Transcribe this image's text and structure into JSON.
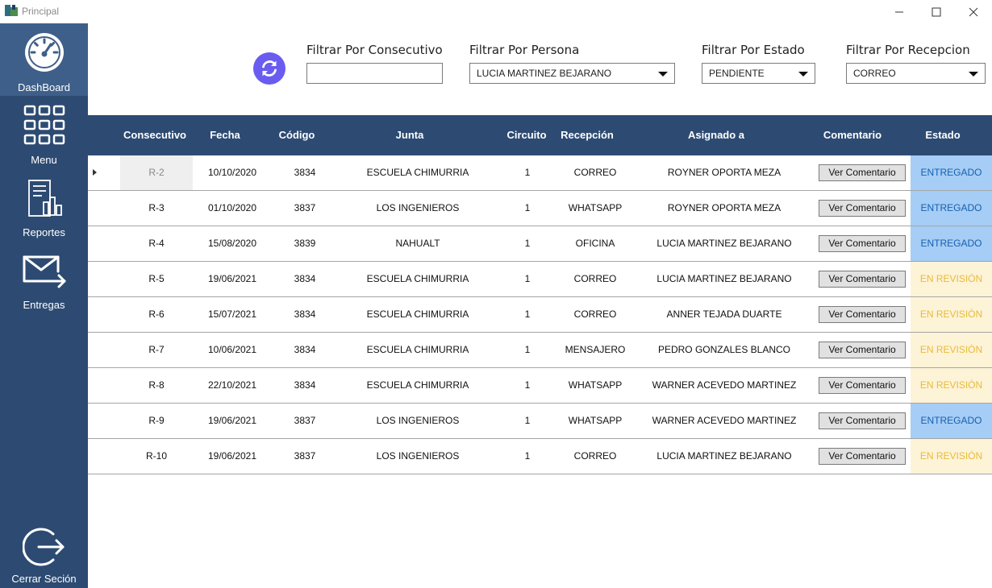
{
  "window": {
    "title": "Principal"
  },
  "sidebar": {
    "items": [
      {
        "label": "DashBoard",
        "icon": "speedometer-icon"
      },
      {
        "label": "Menu",
        "icon": "grid-menu-icon"
      },
      {
        "label": "Reportes",
        "icon": "report-icon"
      },
      {
        "label": "Entregas",
        "icon": "mail-send-icon"
      }
    ],
    "logout": {
      "label": "Cerrar Seción",
      "icon": "logout-icon"
    }
  },
  "filters": {
    "consecutivo": {
      "label": "Filtrar Por Consecutivo",
      "value": ""
    },
    "persona": {
      "label": "Filtrar Por Persona",
      "value": "LUCIA MARTINEZ BEJARANO"
    },
    "estado": {
      "label": "Filtrar Por Estado",
      "value": "PENDIENTE"
    },
    "recepcion": {
      "label": "Filtrar Por Recepcion",
      "value": "CORREO"
    }
  },
  "table": {
    "columns": [
      "Consecutivo",
      "Fecha",
      "Código",
      "Junta",
      "Circuito",
      "Recepción",
      "Asignado a",
      "Comentario",
      "Estado"
    ],
    "button_label": "Ver Comentario",
    "rows": [
      {
        "consecutivo": "R-2",
        "fecha": "10/10/2020",
        "codigo": "3834",
        "junta": "ESCUELA CHIMURRIA",
        "circuito": "1",
        "recepcion": "CORREO",
        "asignado": "ROYNER OPORTA MEZA",
        "estado": "ENTREGADO",
        "tipo": "ok"
      },
      {
        "consecutivo": "R-3",
        "fecha": "01/10/2020",
        "codigo": "3837",
        "junta": "LOS INGENIEROS",
        "circuito": "1",
        "recepcion": "WHATSAPP",
        "asignado": "ROYNER OPORTA MEZA",
        "estado": "ENTREGADO",
        "tipo": "ok"
      },
      {
        "consecutivo": "R-4",
        "fecha": "15/08/2020",
        "codigo": "3839",
        "junta": "NAHUALT",
        "circuito": "1",
        "recepcion": "OFICINA",
        "asignado": "LUCIA MARTINEZ BEJARANO",
        "estado": "ENTREGADO",
        "tipo": "ok"
      },
      {
        "consecutivo": "R-5",
        "fecha": "19/06/2021",
        "codigo": "3834",
        "junta": "ESCUELA CHIMURRIA",
        "circuito": "1",
        "recepcion": "CORREO",
        "asignado": "LUCIA MARTINEZ BEJARANO",
        "estado": "EN REVISIÓN",
        "tipo": "rev"
      },
      {
        "consecutivo": "R-6",
        "fecha": "15/07/2021",
        "codigo": "3834",
        "junta": "ESCUELA CHIMURRIA",
        "circuito": "1",
        "recepcion": "CORREO",
        "asignado": "ANNER TEJADA DUARTE",
        "estado": "EN REVISIÓN",
        "tipo": "rev"
      },
      {
        "consecutivo": "R-7",
        "fecha": "10/06/2021",
        "codigo": "3834",
        "junta": "ESCUELA CHIMURRIA",
        "circuito": "1",
        "recepcion": "MENSAJERO",
        "asignado": "PEDRO GONZALES BLANCO",
        "estado": "EN REVISIÓN",
        "tipo": "rev"
      },
      {
        "consecutivo": "R-8",
        "fecha": "22/10/2021",
        "codigo": "3834",
        "junta": "ESCUELA CHIMURRIA",
        "circuito": "1",
        "recepcion": "WHATSAPP",
        "asignado": "WARNER ACEVEDO MARTINEZ",
        "estado": "EN REVISIÓN",
        "tipo": "rev"
      },
      {
        "consecutivo": "R-9",
        "fecha": "19/06/2021",
        "codigo": "3837",
        "junta": "LOS INGENIEROS",
        "circuito": "1",
        "recepcion": "WHATSAPP",
        "asignado": "WARNER ACEVEDO MARTINEZ",
        "estado": "ENTREGADO",
        "tipo": "ok"
      },
      {
        "consecutivo": "R-10",
        "fecha": "19/06/2021",
        "codigo": "3837",
        "junta": "LOS INGENIEROS",
        "circuito": "1",
        "recepcion": "CORREO",
        "asignado": "LUCIA MARTINEZ BEJARANO",
        "estado": "EN REVISIÓN",
        "tipo": "rev"
      }
    ]
  },
  "colors": {
    "sidebar": "#2d4b72",
    "accent": "#6a5cf0",
    "entregado_bg": "#a6cdf5",
    "revision_bg": "#fdf3d7"
  }
}
